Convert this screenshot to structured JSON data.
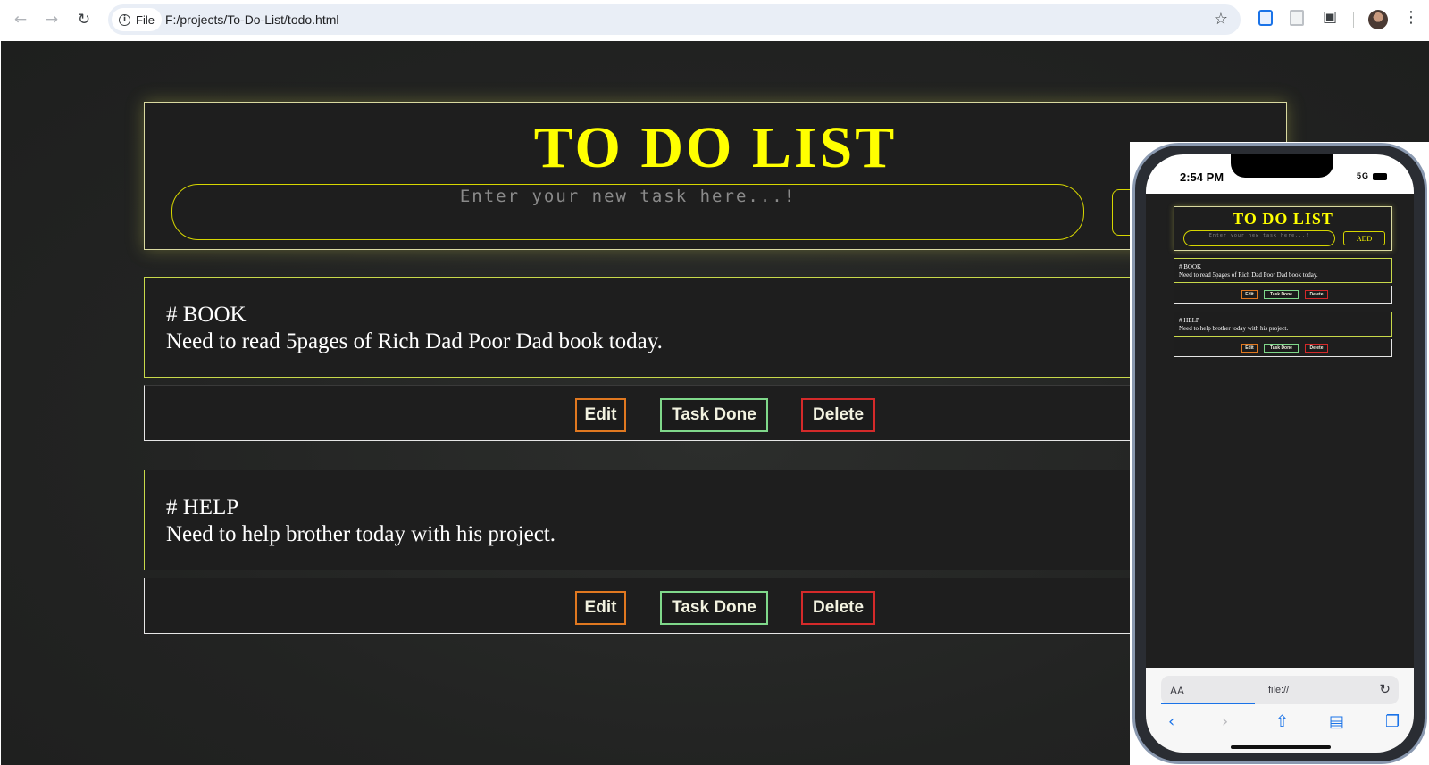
{
  "browser": {
    "site_chip": "File",
    "url": "F:/projects/To-Do-List/todo.html",
    "icons": {
      "back": "arrow-left-icon",
      "forward": "arrow-right-icon",
      "reload": "reload-icon",
      "info": "info-icon",
      "bookmark": "star-icon",
      "menu": "kebab-menu-icon"
    }
  },
  "app": {
    "title": "TO DO LIST",
    "input_placeholder": "Enter your new task here...!",
    "input_value": "",
    "tasks": [
      {
        "tag": "# BOOK",
        "text": "Need to read 5pages of Rich Dad Poor Dad book today."
      },
      {
        "tag": "# HELP",
        "text": "Need to help brother today with his project."
      }
    ],
    "buttons": {
      "edit": "Edit",
      "done": "Task Done",
      "delete": "Delete"
    },
    "colors": {
      "title": "#ffff00",
      "edit_border": "#e07820",
      "done_border": "#7fd88a",
      "delete_border": "#d42a2a"
    }
  },
  "phone": {
    "time": "2:54 PM",
    "network": "5G",
    "title": "TO DO LIST",
    "input_placeholder": "Enter your new task here...!",
    "add_label": "ADD",
    "tasks": [
      {
        "tag": "# BOOK",
        "text": "Need to read 5pages of Rich Dad Poor Dad book today."
      },
      {
        "tag": "# HELP",
        "text": "Need to help brother today with his project."
      }
    ],
    "buttons": {
      "edit": "Edit",
      "done": "Task Done",
      "delete": "Delete"
    },
    "address": {
      "text_size": "AA",
      "url": "file://"
    }
  }
}
